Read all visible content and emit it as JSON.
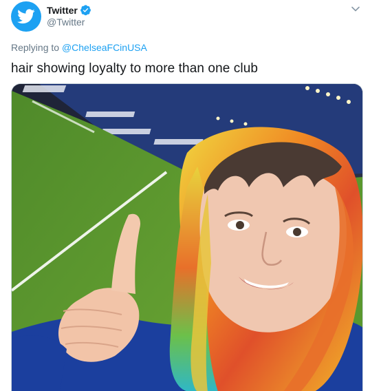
{
  "author": {
    "display_name": "Twitter",
    "handle": "@Twitter",
    "verified": true,
    "avatar_icon": "twitter-bird-icon"
  },
  "reply": {
    "prefix": "Replying to",
    "mention": "@ChelseaFCinUSA"
  },
  "tweet": {
    "text": "hair showing loyalty to more than one club"
  },
  "menu": {
    "icon": "chevron-down-icon"
  },
  "colors": {
    "brand": "#1da1f2",
    "text": "#14171a",
    "secondary": "#657786"
  }
}
